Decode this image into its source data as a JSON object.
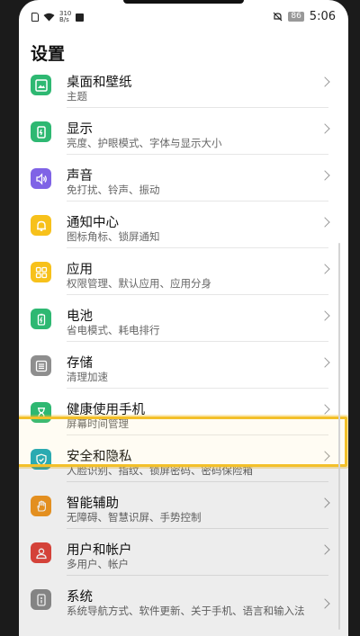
{
  "status_bar": {
    "speed_value": "310",
    "speed_unit": "B/s",
    "battery": "86",
    "time": "5:06"
  },
  "page": {
    "title": "设置"
  },
  "items": [
    {
      "title": "桌面和壁纸",
      "subtitle": "主题",
      "icon": "wallpaper-icon",
      "color": "#2eb872"
    },
    {
      "title": "显示",
      "subtitle": "亮度、护眼模式、字体与显示大小",
      "icon": "display-icon",
      "color": "#2eb872"
    },
    {
      "title": "声音",
      "subtitle": "免打扰、铃声、振动",
      "icon": "sound-icon",
      "color": "#7f63e6"
    },
    {
      "title": "通知中心",
      "subtitle": "图标角标、锁屏通知",
      "icon": "bell-icon",
      "color": "#f7c11b"
    },
    {
      "title": "应用",
      "subtitle": "权限管理、默认应用、应用分身",
      "icon": "apps-grid-icon",
      "color": "#f7c11b"
    },
    {
      "title": "电池",
      "subtitle": "省电模式、耗电排行",
      "icon": "battery-icon",
      "color": "#2eb872"
    },
    {
      "title": "存储",
      "subtitle": "清理加速",
      "icon": "storage-icon",
      "color": "#8e8e8e"
    },
    {
      "title": "健康使用手机",
      "subtitle": "屏幕时间管理",
      "icon": "hourglass-icon",
      "color": "#2eb872"
    },
    {
      "title": "安全和隐私",
      "subtitle": "人脸识别、指纹、锁屏密码、密码保险箱",
      "icon": "shield-icon",
      "color": "#1aa7b8"
    },
    {
      "title": "智能辅助",
      "subtitle": "无障碍、智慧识屏、手势控制",
      "icon": "hand-icon",
      "color": "#f59a23"
    },
    {
      "title": "用户和帐户",
      "subtitle": "多用户、帐户",
      "icon": "user-icon",
      "color": "#e5473e"
    },
    {
      "title": "系统",
      "subtitle": "系统导航方式、软件更新、关于手机、语言和输入法",
      "icon": "system-icon",
      "color": "#8e8e8e"
    }
  ],
  "colors": {
    "highlight_border": "#f3c02a",
    "chevron": "#9a9a9a"
  }
}
